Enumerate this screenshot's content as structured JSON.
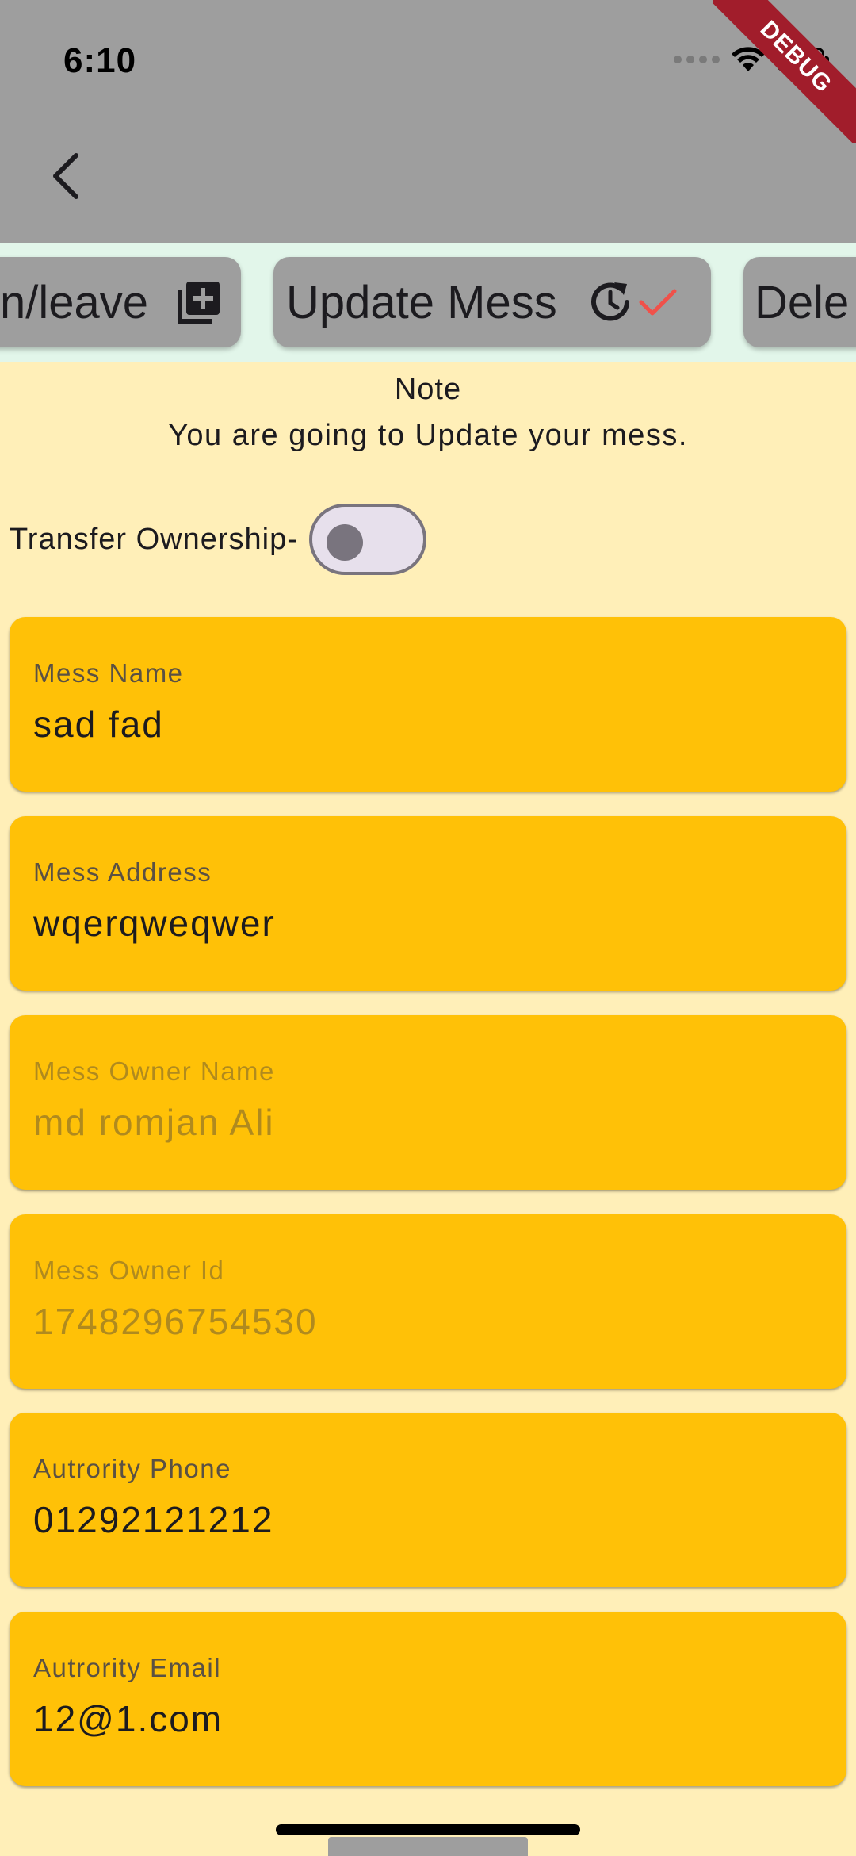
{
  "status_bar": {
    "time": "6:10"
  },
  "debug_banner": "DEBUG",
  "actions": {
    "join_leave": "n/leave",
    "update": "Update Mess",
    "delete": "Dele"
  },
  "note": {
    "title": "Note",
    "text": "You are going to Update your mess."
  },
  "transfer": {
    "label": "Transfer Ownership-",
    "enabled": false
  },
  "fields": [
    {
      "label": "Mess Name",
      "value": "sad fad",
      "enabled": true
    },
    {
      "label": "Mess Address",
      "value": "wqerqweqwer",
      "enabled": true
    },
    {
      "label": "Mess Owner Name",
      "value": "md romjan Ali",
      "enabled": false
    },
    {
      "label": "Mess Owner Id",
      "value": "1748296754530",
      "enabled": false
    },
    {
      "label": "Autrority Phone",
      "value": "01292121212",
      "enabled": true
    },
    {
      "label": "Autrority Email",
      "value": "12@1.com",
      "enabled": true
    }
  ],
  "colors": {
    "background": "#FFEFB8",
    "appbar": "#9E9E9E",
    "action_strip": "#E2F6EA",
    "field": "#FFC107",
    "accent_check": "#F0514A",
    "debug_ribbon": "#A11D2B"
  }
}
